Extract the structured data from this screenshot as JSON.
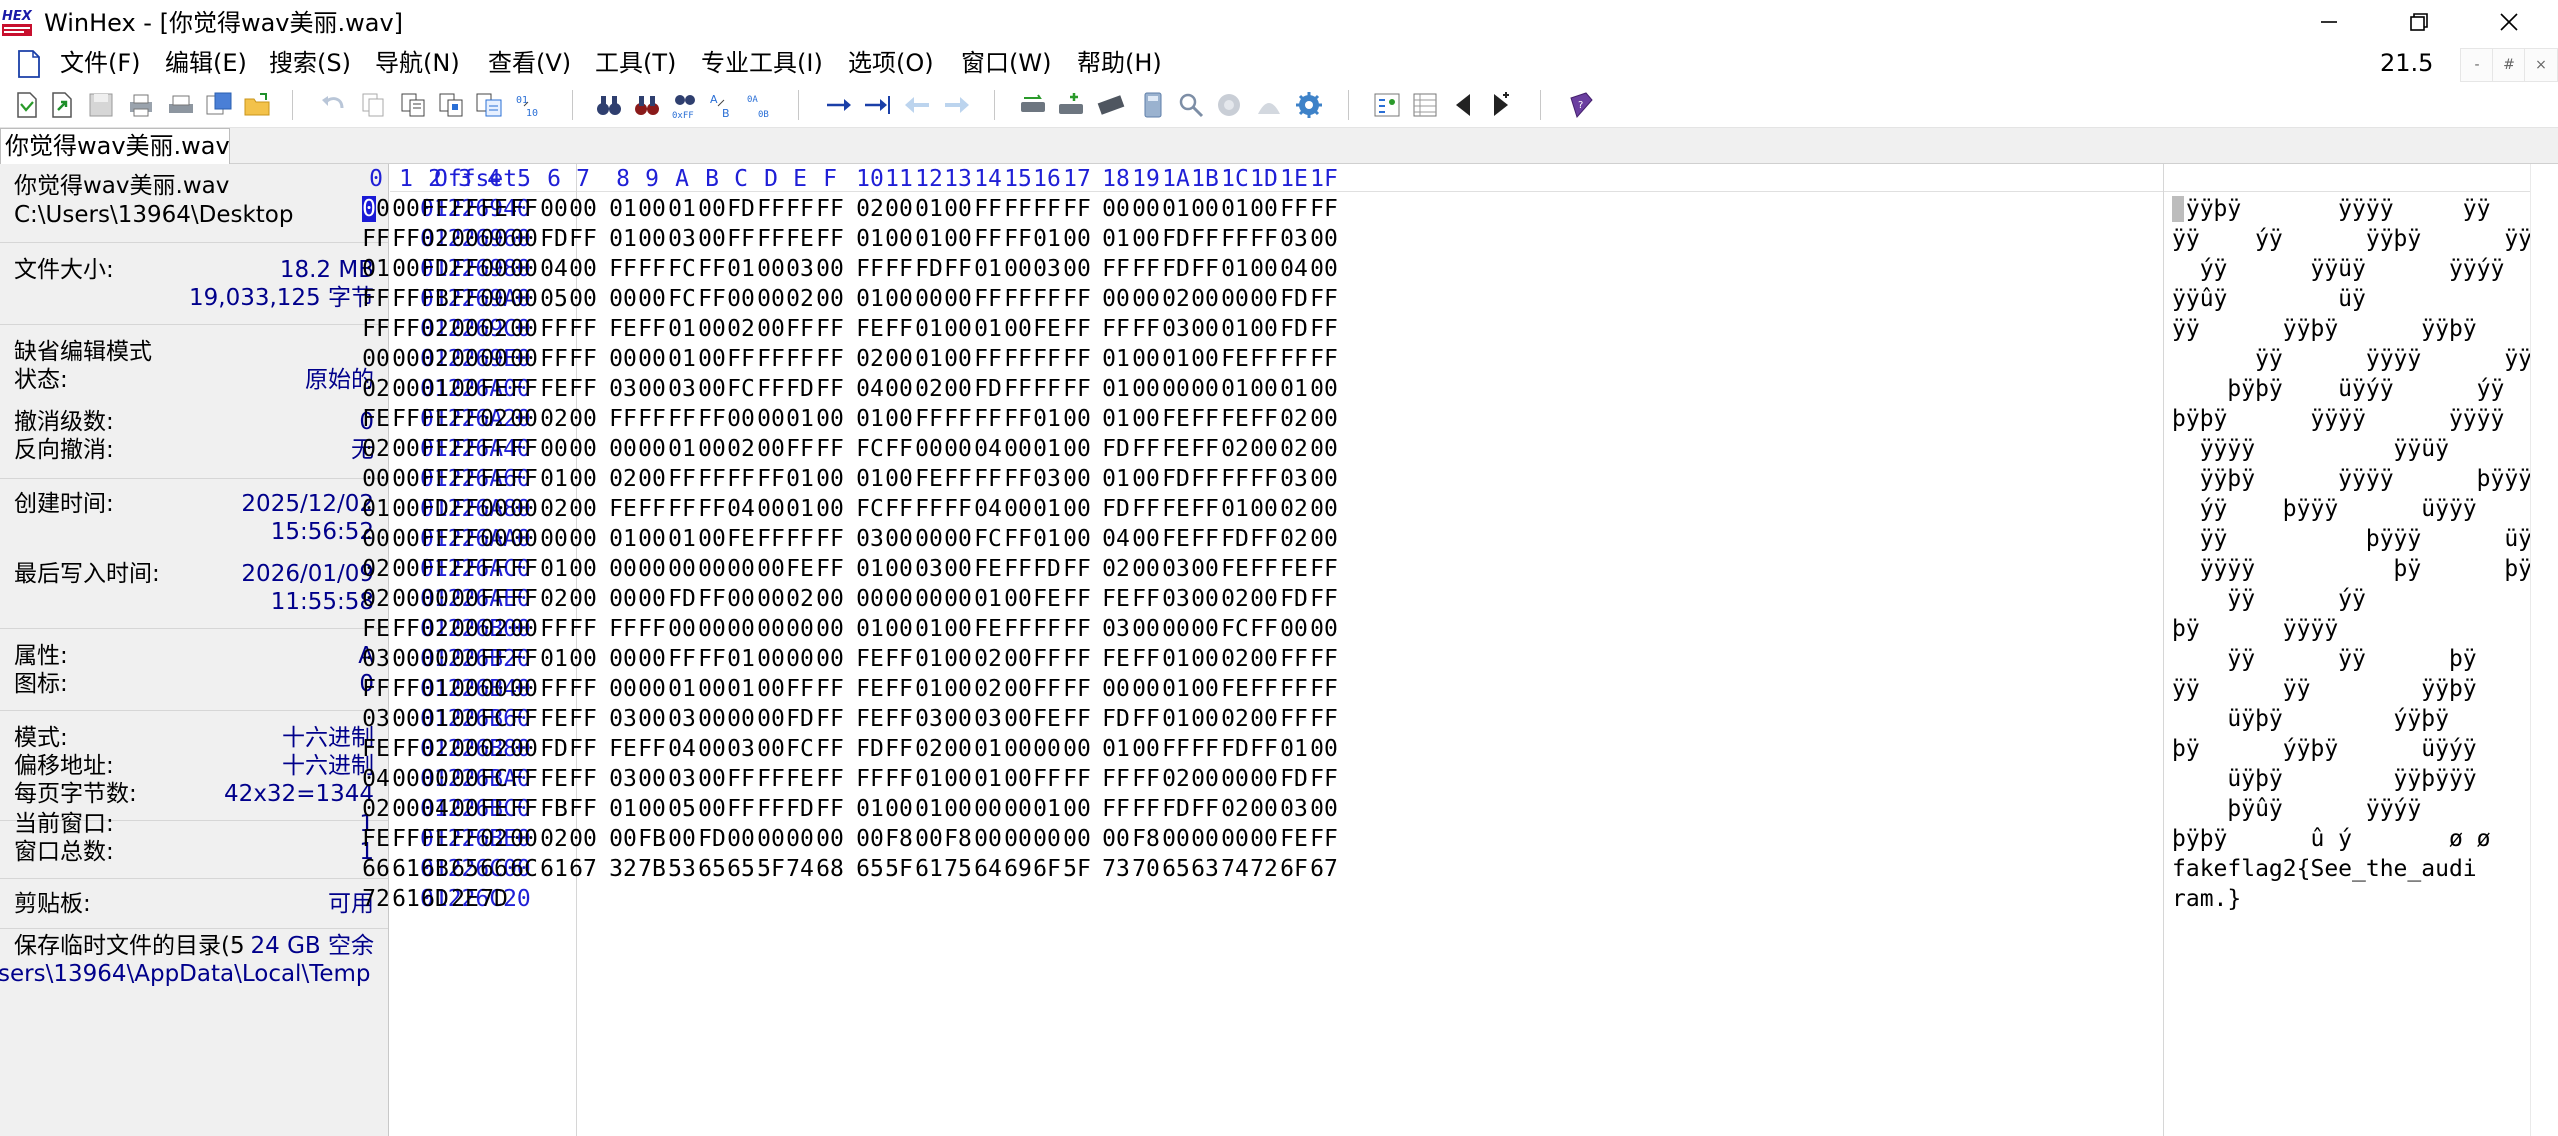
{
  "window": {
    "title": "WinHex - [你觉得wav美丽.wav]",
    "logo_text": "HEX"
  },
  "menu": {
    "items": [
      "文件(F)",
      "编辑(E)",
      "搜索(S)",
      "导航(N)",
      "查看(V)",
      "工具(T)",
      "专业工具(I)",
      "选项(O)",
      "窗口(W)",
      "帮助(H)"
    ],
    "zoom": "21.5",
    "mdi_buttons": [
      "-",
      "#",
      "×"
    ]
  },
  "toolbar": {
    "icons": [
      "new-file-icon",
      "open-file-icon",
      "save-icon",
      "print-icon",
      "print-setup-icon",
      "properties-icon",
      "open-folder-icon",
      "undo-icon",
      "copy-icon",
      "cut-icon",
      "paste-icon",
      "paste-block-icon",
      "write-icon",
      "binoculars-find-icon",
      "binoculars-replace-icon",
      "find-hex-icon",
      "replace-text-icon",
      "replace-hex-icon",
      "goto-offset-icon",
      "goto-block-icon",
      "back-icon",
      "forward-icon",
      "open-disk-icon",
      "clone-disk-icon",
      "ram-icon",
      "calculator-icon",
      "magnify-icon",
      "analyze-icon",
      "gauge-icon",
      "settings-gear-icon",
      "data-interpreter-icon",
      "template-icon",
      "prev-file-icon",
      "next-file-icon",
      "help-book-icon"
    ]
  },
  "tab": {
    "label": "你觉得wav美丽.wav"
  },
  "info": {
    "file_name": "你觉得wav美丽.wav",
    "file_path": "C:\\Users\\13964\\Desktop",
    "size_label": "文件大小:",
    "size_mb": "18.2 MB",
    "size_bytes": "19,033,125 字节",
    "edit_mode_label": "缺省编辑模式",
    "state_label": "状态:",
    "state_value": "原始的",
    "undo_level_label": "撤消级数:",
    "undo_level_value": "0",
    "redo_label": "反向撤消:",
    "redo_value": "无",
    "created_label": "创建时间:",
    "created_date": "2025/12/02",
    "created_time": "15:56:52",
    "modified_label": "最后写入时间:",
    "modified_date": "2026/01/09",
    "modified_time": "11:55:58",
    "attr_label": "属性:",
    "attr_value": "A",
    "icon_label": "图标:",
    "icon_value": "0",
    "mode_label": "模式:",
    "mode_value": "十六进制",
    "offset_label": "偏移地址:",
    "offset_value": "十六进制",
    "bpp_label": "每页字节数:",
    "bpp_value": "42x32=1344",
    "cur_window_label": "当前窗口:",
    "cur_window_value": "1",
    "total_windows_label": "窗口总数:",
    "total_windows_value": "1",
    "clipboard_label": "剪贴板:",
    "clipboard_value": "可用",
    "temp_dir_label": "保存临时文件的目录(5",
    "temp_dir_space": "24 GB 空余",
    "temp_dir_path": "sers\\13964\\AppData\\Local\\Temp"
  },
  "hex": {
    "offset_header": "Offset",
    "column_headers": [
      "0",
      "1",
      "2",
      "3",
      "4",
      "5",
      "6",
      "7",
      "8",
      "9",
      "A",
      "B",
      "C",
      "D",
      "E",
      "F",
      "10",
      "11",
      "12",
      "13",
      "14",
      "15",
      "16",
      "17",
      "18",
      "19",
      "1A",
      "1B",
      "1C",
      "1D",
      "1E",
      "1F"
    ],
    "rows": [
      {
        "offset": "01226940",
        "bytes": "00 00 FF FF FE FF 00 00 01 00 01 00 FD FF FF FF 02 00 01 00 FF FF FF FF 00 00 01 00 01 00 FF FF",
        "text": " ÿÿþÿ       ÿÿÿÿ     ÿÿ"
      },
      {
        "offset": "01226960",
        "bytes": "FF FF 02 00 00 00 FD FF 01 00 03 00 FF FF FE FF 01 00 01 00 FF FF 01 00 01 00 FD FF FF FF 03 00",
        "text": "ÿÿ    ýÿ      ÿÿþÿ      ÿÿ"
      },
      {
        "offset": "01226980",
        "bytes": "01 00 FD FF 00 00 04 00 FF FF FC FF 01 00 03 00 FF FF FD FF 01 00 03 00 FF FF FD FF 01 00 04 00",
        "text": "  ýÿ      ÿÿüÿ      ÿÿýÿ"
      },
      {
        "offset": "012269A0",
        "bytes": "FF FF FB FF 00 00 05 00 00 00 FC FF 00 00 02 00 01 00 00 00 FF FF FF FF 00 00 02 00 00 00 FD FF",
        "text": "ÿÿûÿ        üÿ            ÿÿ"
      },
      {
        "offset": "012269C0",
        "bytes": "FF FF 02 00 02 00 FF FF FE FF 01 00 02 00 FF FF FE FF 01 00 01 00 FE FF FF FF 03 00 01 00 FD FF",
        "text": "ÿÿ      ÿÿþÿ      ÿÿþÿ"
      },
      {
        "offset": "012269E0",
        "bytes": "00 00 02 00 00 00 FF FF 00 00 01 00 FF FF FF FF 02 00 01 00 FF FF FF FF 01 00 01 00 FE FF FF FF",
        "text": "      ÿÿ      ÿÿÿÿ      ÿÿ"
      },
      {
        "offset": "01226A00",
        "bytes": "02 00 01 00 FE FF FE FF 03 00 03 00 FC FF FD FF 04 00 02 00 FD FF FF FF 01 00 00 00 01 00 01 00",
        "text": "    þÿþÿ    üÿýÿ      ýÿ"
      },
      {
        "offset": "01226A20",
        "bytes": "FE FF FE FF 02 00 02 00 FF FF FF FF 00 00 01 00 01 00 FF FF FF FF 01 00 01 00 FE FF FE FF 02 00",
        "text": "þÿþÿ      ÿÿÿÿ      ÿÿÿÿ"
      },
      {
        "offset": "01226A40",
        "bytes": "02 00 FF FF FF FF 00 00 00 00 01 00 02 00 FF FF FC FF 00 00 04 00 01 00 FD FF FE FF 02 00 02 00",
        "text": "  ÿÿÿÿ          ÿÿüÿ"
      },
      {
        "offset": "01226A60",
        "bytes": "00 00 FF FF FE FF 01 00 02 00 FF FF FF FF 01 00 01 00 FE FF FF FF 03 00 01 00 FD FF FF FF 03 00",
        "text": "  ÿÿþÿ      ÿÿÿÿ      þÿÿÿ"
      },
      {
        "offset": "01226A80",
        "bytes": "01 00 FD FF 00 00 02 00 FE FF FF FF 04 00 01 00 FC FF FF FF 04 00 01 00 FD FF FE FF 01 00 02 00",
        "text": "  ýÿ    þÿÿÿ      üÿÿÿ"
      },
      {
        "offset": "01226AA0",
        "bytes": "00 00 FF FF 00 00 00 00 01 00 01 00 FE FF FF FF 03 00 00 00 FC FF 01 00 04 00 FE FF FD FF 02 00",
        "text": "  ÿÿ          þÿÿÿ      üÿ"
      },
      {
        "offset": "01226AC0",
        "bytes": "02 00 FF FF FF FF 01 00 00 00 00 00 00 00 FE FF 01 00 03 00 FE FF FD FF 02 00 03 00 FE FF FE FF",
        "text": "  ÿÿÿÿ          þÿ      þÿ"
      },
      {
        "offset": "01226AE0",
        "bytes": "02 00 00 00 FF FF 02 00 00 00 FD FF 00 00 02 00 00 00 00 00 01 00 FE FF FE FF 03 00 02 00 FD FF",
        "text": "    ÿÿ      ýÿ"
      },
      {
        "offset": "01226B00",
        "bytes": "FE FF 02 00 02 00 FF FF FF FF 00 00 00 00 00 00 01 00 01 00 FE FF FF FF 03 00 00 00 FC FF 00 00",
        "text": "þÿ      ÿÿÿÿ              þÿ"
      },
      {
        "offset": "01226B20",
        "bytes": "03 00 00 00 FF FF 01 00 00 00 FF FF 01 00 00 00 FE FF 01 00 02 00 FF FF FE FF 01 00 02 00 FF FF",
        "text": "    ÿÿ      ÿÿ      þÿ"
      },
      {
        "offset": "01226B40",
        "bytes": "FF FF 01 00 00 00 FF FF 00 00 01 00 01 00 FF FF FE FF 01 00 02 00 FF FF 00 00 01 00 FE FF FF FF",
        "text": "ÿÿ      ÿÿ        ÿÿþÿ"
      },
      {
        "offset": "01226B60",
        "bytes": "03 00 01 00 FC FF FE FF 03 00 03 00 00 00 FD FF FE FF 03 00 03 00 FE FF FD FF 01 00 02 00 FF FF",
        "text": "    üÿþÿ        ýÿþÿ"
      },
      {
        "offset": "01226B80",
        "bytes": "FE FF 02 00 02 00 FD FF FE FF 04 00 03 00 FC FF FD FF 02 00 01 00 00 00 01 00 FF FF FD FF 01 00",
        "text": "þÿ      ýÿþÿ      üÿýÿ"
      },
      {
        "offset": "01226BA0",
        "bytes": "04 00 00 00 FC FF FE FF 03 00 03 00 FF FF FE FF FF FF 01 00 01 00 FF FF FF FF 02 00 00 00 FD FF",
        "text": "    üÿþÿ        ÿÿþÿÿÿ"
      },
      {
        "offset": "01226BC0",
        "bytes": "02 00 04 00 FE FF FB FF 01 00 05 00 FF FF FD FF 01 00 01 00 00 00 01 00 FF FF FD FF 02 00 03 00",
        "text": "    þÿûÿ      ÿÿýÿ"
      },
      {
        "offset": "01226BE0",
        "bytes": "FE FF FE FF 02 00 02 00 00 FB 00 FD 00 00 00 00 00 F8 00 F8 00 00 00 00 00 F8 00 00 00 00 FE FF",
        "text": "þÿþÿ      û ý       ø ø"
      },
      {
        "offset": "01226C00",
        "bytes": "66 61 6B 65 66 6C 61 67 32 7B 53 65 65 5F 74 68 65 5F 61 75 64 69 6F 5F 73 70 65 63 74 72 6F 67",
        "text": "fakeflag2{See_the_audi"
      },
      {
        "offset": "01226C20",
        "bytes": "72 61 6D 2E 7D",
        "text": "ram.}"
      }
    ]
  }
}
